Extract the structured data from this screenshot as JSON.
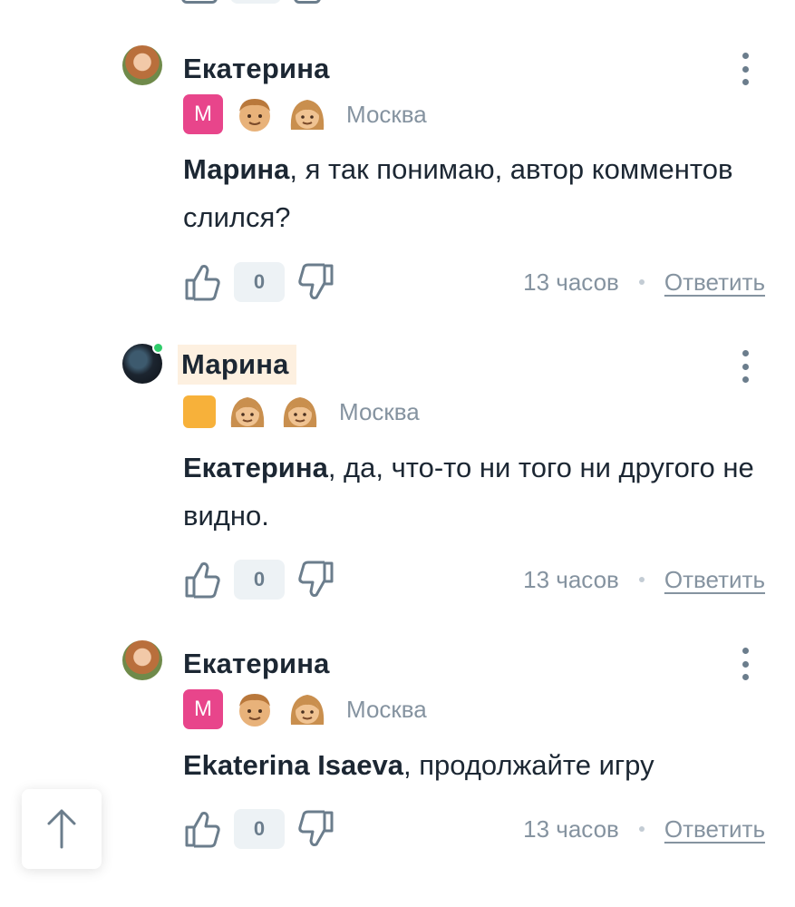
{
  "comments": [
    {
      "author": "Екатерина",
      "badge_letter": "М",
      "city": "Москва",
      "mention": "Марина",
      "text": ", я так понимаю, автор комментов слился?",
      "likes": "0",
      "time": "13 часов",
      "reply_label": "Ответить"
    },
    {
      "author": "Марина",
      "city": "Москва",
      "mention": "Екатерина",
      "text": ", да, что-то ни того ни другого не видно.",
      "likes": "0",
      "time": "13 часов",
      "reply_label": "Ответить"
    },
    {
      "author": "Екатерина",
      "badge_letter": "М",
      "city": "Москва",
      "mention": "Ekaterina Isaeva",
      "text": ", продолжайте игру",
      "likes": "0",
      "time": "13 часов",
      "reply_label": "Ответить"
    }
  ],
  "colors": {
    "badge_pink": "#e8458b",
    "badge_orange": "#f7b13a",
    "online": "#2fcc6a",
    "muted": "#8593a0",
    "highlight": "#fdf0e0"
  },
  "icons": {
    "like": "thumbs-up-icon",
    "dislike": "thumbs-down-icon",
    "more": "kebab-menu-icon",
    "scroll_top": "arrow-up-icon"
  }
}
